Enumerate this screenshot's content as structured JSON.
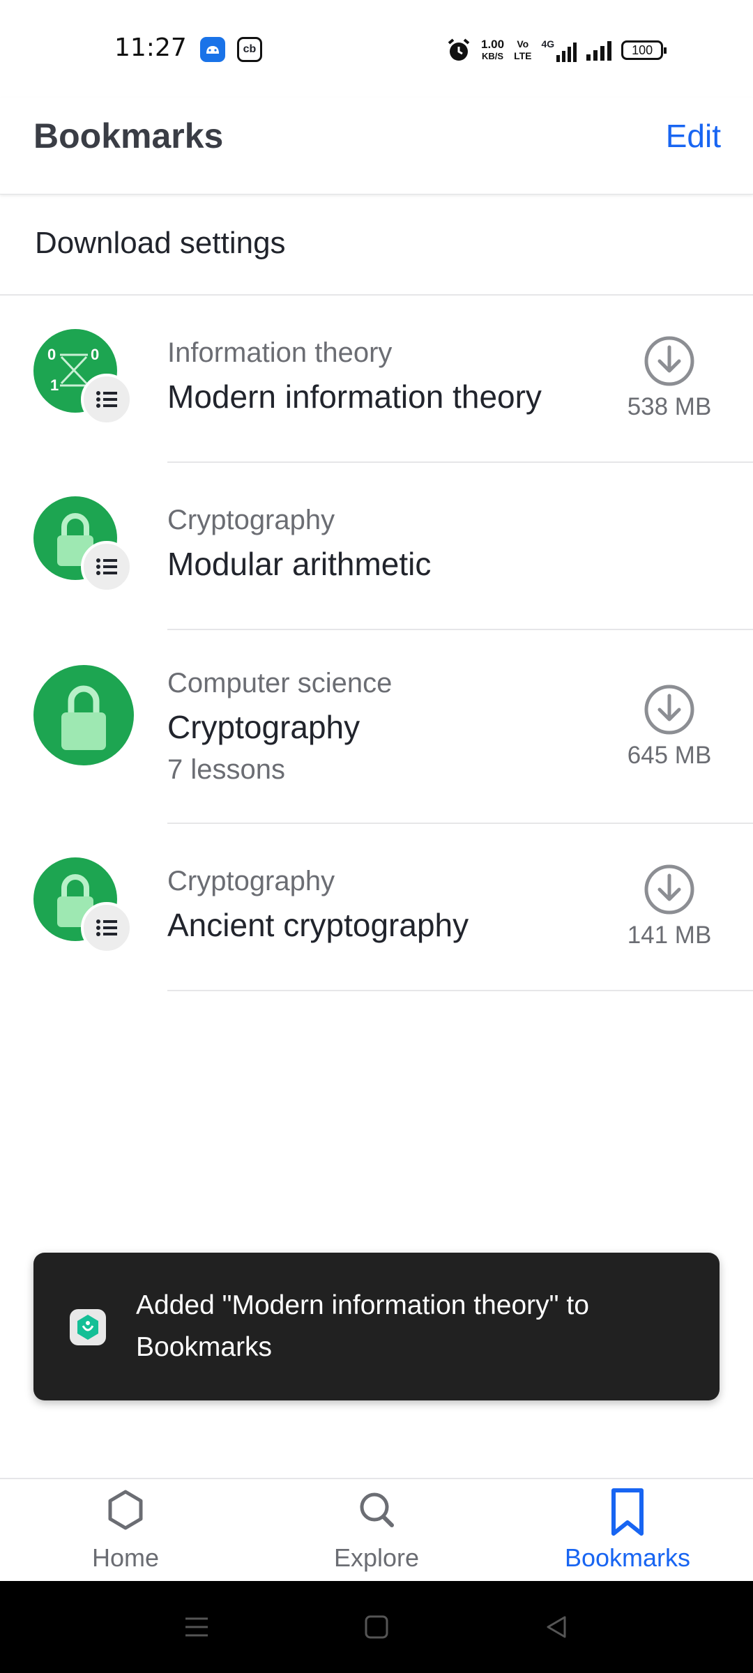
{
  "status_bar": {
    "time": "11:27",
    "net_speed": "1.00",
    "net_speed_unit": "KB/S",
    "volte": "Vo\nLTE",
    "network": "4G",
    "battery": "100"
  },
  "header": {
    "title": "Bookmarks",
    "edit_label": "Edit"
  },
  "download_settings_label": "Download settings",
  "bookmarks": [
    {
      "subtitle": "Information theory",
      "title": "Modern information theory",
      "size": "538 MB",
      "has_badge": true,
      "icon": "information-theory-icon"
    },
    {
      "subtitle": "Cryptography",
      "title": "Modular arithmetic",
      "size": "",
      "has_badge": true,
      "icon": "padlock-icon"
    },
    {
      "subtitle": "Computer science",
      "title": "Cryptography",
      "meta": "7 lessons",
      "size": "645 MB",
      "has_badge": false,
      "icon": "padlock-icon"
    },
    {
      "subtitle": "Cryptography",
      "title": "Ancient cryptography",
      "size": "141 MB",
      "has_badge": true,
      "icon": "padlock-icon"
    }
  ],
  "snackbar": {
    "text": "Added \"Modern information theory\" to Bookmarks"
  },
  "bottom_nav": [
    {
      "label": "Home",
      "icon": "hexagon-home-icon",
      "active": false
    },
    {
      "label": "Explore",
      "icon": "search-icon",
      "active": false
    },
    {
      "label": "Bookmarks",
      "icon": "bookmark-icon",
      "active": true
    }
  ],
  "colors": {
    "accent": "#1865f2",
    "topic_green": "#1da551",
    "snackbar_bg": "#212121"
  }
}
